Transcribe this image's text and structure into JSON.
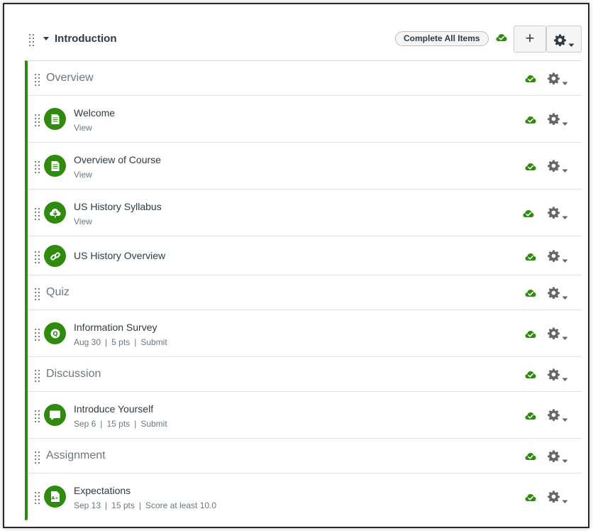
{
  "module": {
    "title": "Introduction",
    "complete_all_label": "Complete All Items",
    "add_label": "+"
  },
  "colors": {
    "accent_green": "#2e8b0e",
    "text_dark": "#2d3b45",
    "text_muted": "#6b7780"
  },
  "items": [
    {
      "kind": "header",
      "title": "Overview"
    },
    {
      "kind": "item",
      "title": "Welcome",
      "icon": "page-icon",
      "details": [
        "View"
      ]
    },
    {
      "kind": "item",
      "title": "Overview of Course",
      "icon": "page-icon",
      "details": [
        "View"
      ]
    },
    {
      "kind": "item",
      "title": "US History Syllabus",
      "icon": "cloud-download-icon",
      "details": [
        "View"
      ]
    },
    {
      "kind": "item",
      "title": "US History Overview",
      "icon": "link-icon",
      "details": []
    },
    {
      "kind": "header",
      "title": "Quiz"
    },
    {
      "kind": "item",
      "title": "Information Survey",
      "icon": "quiz-icon",
      "details": [
        "Aug 30",
        "5 pts",
        "Submit"
      ]
    },
    {
      "kind": "header",
      "title": "Discussion"
    },
    {
      "kind": "item",
      "title": "Introduce Yourself",
      "icon": "discussion-icon",
      "details": [
        "Sep 6",
        "15 pts",
        "Submit"
      ]
    },
    {
      "kind": "header",
      "title": "Assignment"
    },
    {
      "kind": "item",
      "title": "Expectations",
      "icon": "assignment-icon",
      "details": [
        "Sep 13",
        "15 pts",
        "Score at least 10.0"
      ]
    }
  ]
}
